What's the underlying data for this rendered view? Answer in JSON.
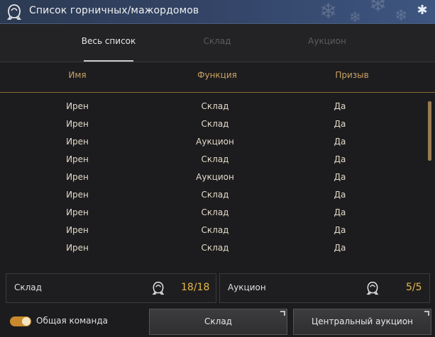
{
  "window": {
    "title": "Список горничных/мажордомов",
    "title_icon": "maid-icon",
    "close_icon": "snowflake-close-icon"
  },
  "tabs": [
    {
      "label": "Весь список",
      "state": "active"
    },
    {
      "label": "Склад",
      "state": "disabled"
    },
    {
      "label": "Аукцион",
      "state": "disabled"
    }
  ],
  "table": {
    "columns": [
      "Имя",
      "Функция",
      "Призыв"
    ],
    "rows": [
      [
        "Ирен",
        "Склад",
        "Да"
      ],
      [
        "Ирен",
        "Склад",
        "Да"
      ],
      [
        "Ирен",
        "Аукцион",
        "Да"
      ],
      [
        "Ирен",
        "Склад",
        "Да"
      ],
      [
        "Ирен",
        "Аукцион",
        "Да"
      ],
      [
        "Ирен",
        "Склад",
        "Да"
      ],
      [
        "Ирен",
        "Склад",
        "Да"
      ],
      [
        "Ирен",
        "Склад",
        "Да"
      ],
      [
        "Ирен",
        "Склад",
        "Да"
      ]
    ]
  },
  "summary": {
    "storage": {
      "label": "Склад",
      "count": "18/18",
      "icon": "maid-icon"
    },
    "auction": {
      "label": "Аукцион",
      "count": "5/5",
      "icon": "maid-icon"
    }
  },
  "footer": {
    "toggle_label": "Общая команда",
    "toggle_on": true,
    "storage_button": "Склад",
    "auction_button": "Центральный аукцион"
  },
  "colors": {
    "accent_gold": "#e7b84a",
    "header_text": "#c9a364",
    "titlebar": "#34466a"
  }
}
